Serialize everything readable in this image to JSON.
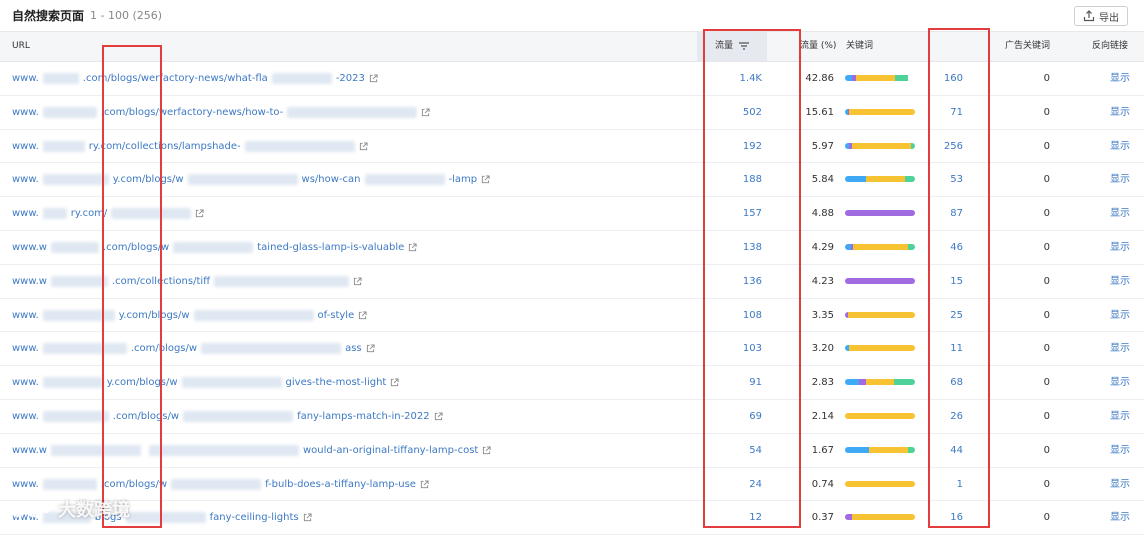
{
  "header": {
    "title": "自然搜索页面",
    "range": "1 - 100 (256)",
    "export_label": "导出"
  },
  "columns": {
    "url": "URL",
    "traffic": "流量",
    "traffic_pct": "流量 (%)",
    "keywords_bar": "关键词",
    "keywords_count": "",
    "ad_keywords": "广告关键词",
    "backlinks": "反向链接"
  },
  "colors": {
    "blue": "#3fa9f5",
    "purple": "#a06be0",
    "yellow": "#f7c332",
    "green": "#4fd29a",
    "red_box": "#e23c3c",
    "link": "#3d79c4"
  },
  "rows": [
    {
      "url_a": "www.",
      "url_b": ".com/blogs/werfactory-news/what-fla",
      "url_c": "-2023",
      "traffic": "1.4K",
      "pct": "42.86",
      "kw": "160",
      "ads": "0",
      "bl": "显示",
      "bar": [
        10,
        6,
        56,
        18
      ]
    },
    {
      "url_a": "www.",
      "url_b": ".com/blogs/werfactory-news/how-to-",
      "url_c": "",
      "traffic": "502",
      "pct": "15.61",
      "kw": "71",
      "ads": "0",
      "bl": "显示",
      "bar": [
        4,
        2,
        94,
        0
      ]
    },
    {
      "url_a": "www.",
      "url_b": "ry.com/collections/lampshade-",
      "url_c": "",
      "traffic": "192",
      "pct": "5.97",
      "kw": "256",
      "ads": "0",
      "bl": "显示",
      "bar": [
        6,
        4,
        84,
        6
      ]
    },
    {
      "url_a": "www.",
      "url_b": "y.com/blogs/w",
      "url_c": "ws/how-can",
      "url_d": "-lamp",
      "traffic": "188",
      "pct": "5.84",
      "kw": "53",
      "ads": "0",
      "bl": "显示",
      "bar": [
        30,
        0,
        56,
        14
      ]
    },
    {
      "url_a": "www.",
      "url_b": "ry.com/",
      "url_c": "",
      "traffic": "157",
      "pct": "4.88",
      "kw": "87",
      "ads": "0",
      "bl": "显示",
      "bar": [
        0,
        100,
        0,
        0
      ]
    },
    {
      "url_a": "www.w",
      "url_b": ".com/blogs/w",
      "url_c": "tained-glass-lamp-is-valuable",
      "traffic": "138",
      "pct": "4.29",
      "kw": "46",
      "ads": "0",
      "bl": "显示",
      "bar": [
        8,
        4,
        78,
        10
      ]
    },
    {
      "url_a": "www.w",
      "url_b": ".com/collections/tiff",
      "url_c": "",
      "traffic": "136",
      "pct": "4.23",
      "kw": "15",
      "ads": "0",
      "bl": "显示",
      "bar": [
        0,
        100,
        0,
        0
      ]
    },
    {
      "url_a": "www.",
      "url_b": "y.com/blogs/w",
      "url_c": "of-style",
      "traffic": "108",
      "pct": "3.35",
      "kw": "25",
      "ads": "0",
      "bl": "显示",
      "bar": [
        0,
        4,
        96,
        0
      ]
    },
    {
      "url_a": "www.",
      "url_b": ".com/blogs/w",
      "url_c": "ass",
      "traffic": "103",
      "pct": "3.20",
      "kw": "11",
      "ads": "0",
      "bl": "显示",
      "bar": [
        6,
        0,
        94,
        0
      ]
    },
    {
      "url_a": "www.",
      "url_b": "y.com/blogs/w",
      "url_c": "gives-the-most-light",
      "traffic": "91",
      "pct": "2.83",
      "kw": "68",
      "ads": "0",
      "bl": "显示",
      "bar": [
        20,
        10,
        40,
        30
      ]
    },
    {
      "url_a": "www.",
      "url_b": ".com/blogs/w",
      "url_c": "fany-lamps-match-in-2022",
      "traffic": "69",
      "pct": "2.14",
      "kw": "26",
      "ads": "0",
      "bl": "显示",
      "bar": [
        0,
        0,
        100,
        0
      ]
    },
    {
      "url_a": "www.w",
      "url_b": "",
      "url_c": "would-an-original-tiffany-lamp-cost",
      "traffic": "54",
      "pct": "1.67",
      "kw": "44",
      "ads": "0",
      "bl": "显示",
      "bar": [
        34,
        0,
        56,
        10
      ]
    },
    {
      "url_a": "www.",
      "url_b": ".com/blogs/w",
      "url_c": "f-bulb-does-a-tiffany-lamp-use",
      "traffic": "24",
      "pct": "0.74",
      "kw": "1",
      "ads": "0",
      "bl": "显示",
      "bar": [
        0,
        0,
        100,
        0
      ]
    },
    {
      "url_a": "www.",
      "url_b": "blogs",
      "url_c": "fany-ceiling-lights",
      "traffic": "12",
      "pct": "0.37",
      "kw": "16",
      "ads": "0",
      "bl": "显示",
      "bar": [
        0,
        10,
        90,
        0
      ]
    }
  ],
  "watermark": {
    "text": "大数跨境"
  }
}
